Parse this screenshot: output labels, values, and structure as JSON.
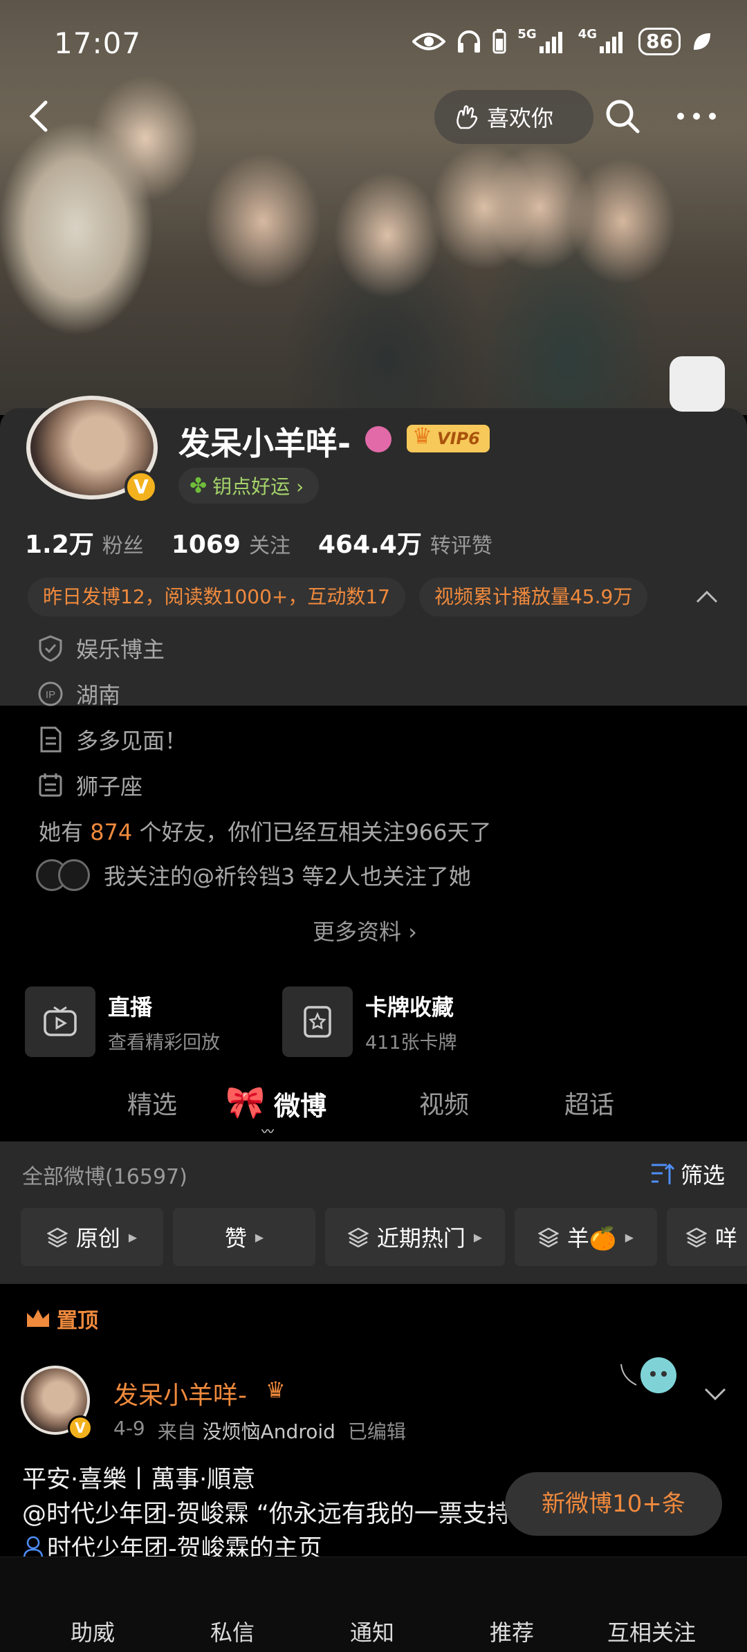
{
  "status_bar": {
    "time": "17:07",
    "sig1_label": "5G",
    "sig2_label": "4G",
    "battery": "86"
  },
  "top_nav": {
    "like_label": "喜欢你"
  },
  "profile": {
    "nickname": "发呆小羊咩-",
    "vip_label": "VIP6",
    "luck_label": "钥点好运 ›",
    "stats": [
      {
        "num": "1.2万",
        "label": "粉丝"
      },
      {
        "num": "1069",
        "label": "关注"
      },
      {
        "num": "464.4万",
        "label": "转评赞"
      }
    ],
    "pills": [
      "昨日发博12，阅读数1000+，互动数17",
      "视频累计播放量45.9万"
    ],
    "info": {
      "category": "娱乐博主",
      "ip": "湖南",
      "bio": "多多见面！",
      "zodiac": "狮子座"
    },
    "friends_prefix": "她有",
    "friends_count": "874",
    "friends_suffix": "个好友，你们已经互相关注966天了",
    "mutual_text": "我关注的@祈铃铛3 等2人也关注了她",
    "more_info": "更多资料 ›"
  },
  "features": [
    {
      "title": "直播",
      "subtitle": "查看精彩回放"
    },
    {
      "title": "卡牌收藏",
      "subtitle": "411张卡牌"
    }
  ],
  "tabs": [
    "精选",
    "微博",
    "视频",
    "超话"
  ],
  "feed": {
    "all_label": "全部微博(16597)",
    "filter_label": "筛选",
    "chips": [
      "原创",
      "赞",
      "近期热门",
      "羊🍊",
      "咩"
    ]
  },
  "pinned_post": {
    "pinned_label": "置顶",
    "author": "发呆小羊咩-",
    "date": "4-9",
    "source_prefix": "来自",
    "source": "没烦恼Android",
    "edited": "已编辑",
    "line1": "平安·喜樂丨萬事·順意",
    "line2": "@时代少年团-贺峻霖 “你永远有我的一票支持”",
    "line3": "时代少年团-贺峻霖的主页"
  },
  "new_posts": "新微博10+条",
  "bottom_bar": [
    "助威",
    "私信",
    "通知",
    "推荐",
    "互相关注"
  ],
  "colors": {
    "accent": "#f08a3d",
    "card_bg": "#2b2b2b",
    "vip": "#f7c85a"
  }
}
